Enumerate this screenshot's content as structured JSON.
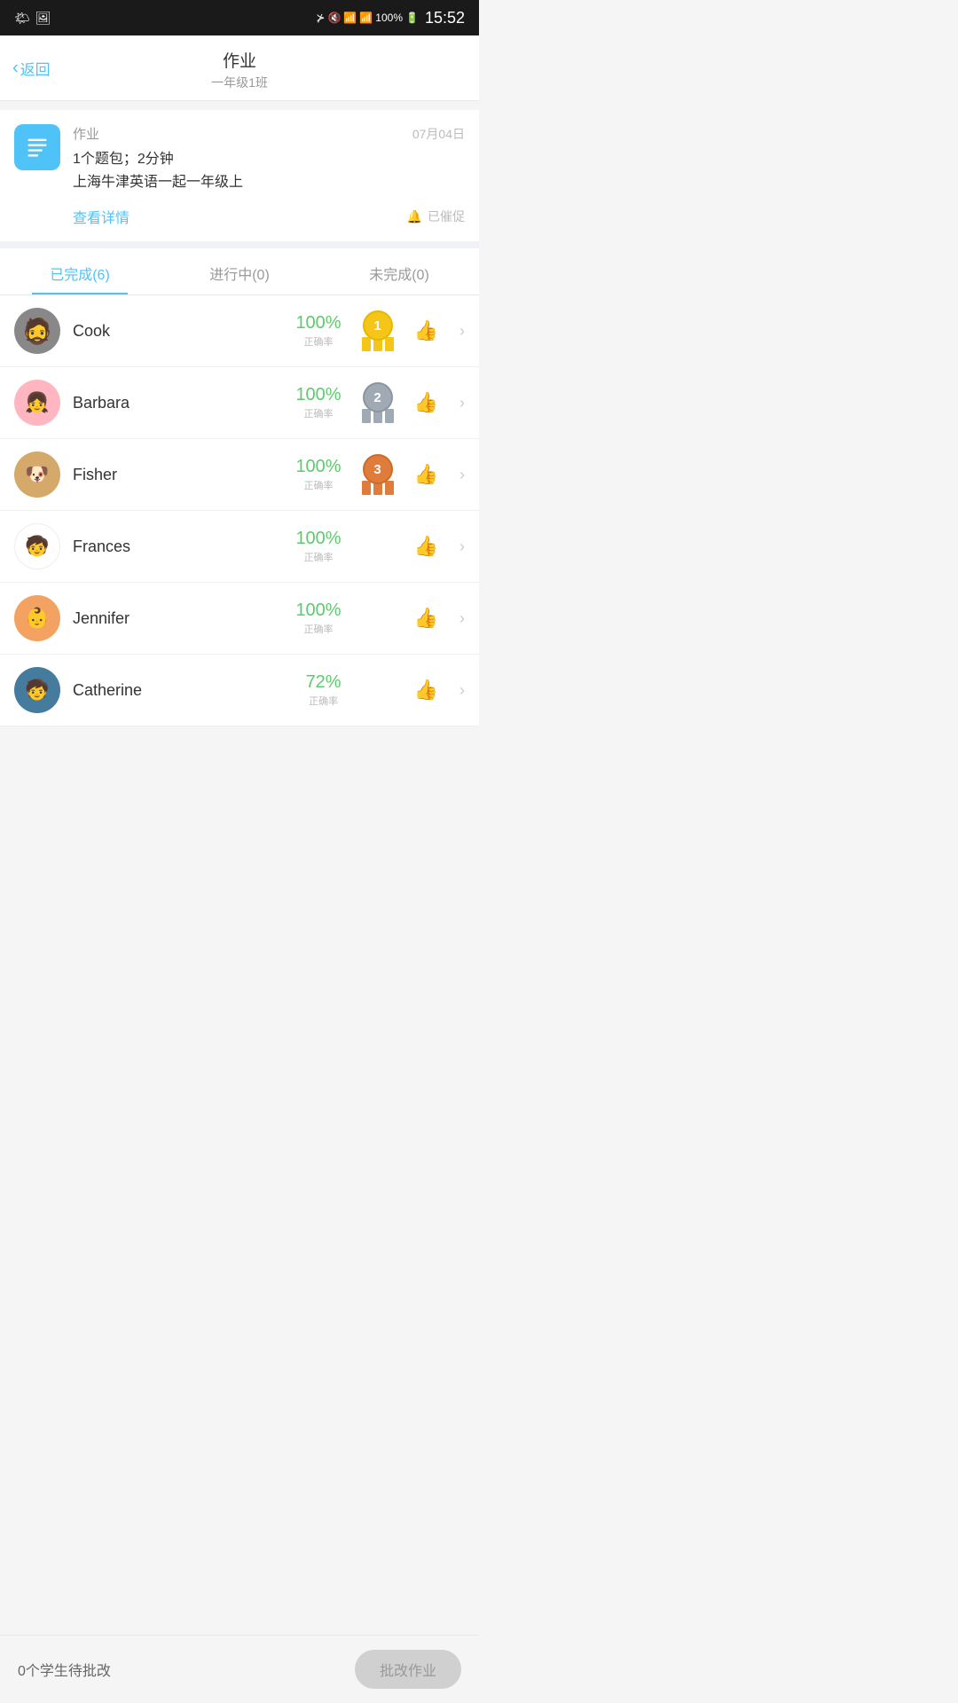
{
  "statusBar": {
    "time": "15:52",
    "battery": "100%"
  },
  "header": {
    "backLabel": "返回",
    "title": "作业",
    "subtitle": "一年级1班"
  },
  "assignment": {
    "label": "作业",
    "date": "07月04日",
    "desc1": "1个题包；2分钟",
    "desc2": "上海牛津英语一起一年级上",
    "viewDetail": "查看详情",
    "notifyLabel": "已催促"
  },
  "tabs": [
    {
      "label": "已完成(6)",
      "active": true
    },
    {
      "label": "进行中(0)",
      "active": false
    },
    {
      "label": "未完成(0)",
      "active": false
    }
  ],
  "students": [
    {
      "name": "Cook",
      "score": "100%",
      "scoreLabel": "正确率",
      "rank": 1,
      "avatarEmoji": "🧔"
    },
    {
      "name": "Barbara",
      "score": "100%",
      "scoreLabel": "正确率",
      "rank": 2,
      "avatarEmoji": "👧"
    },
    {
      "name": "Fisher",
      "score": "100%",
      "scoreLabel": "正确率",
      "rank": 3,
      "avatarEmoji": "🐶"
    },
    {
      "name": "Frances",
      "score": "100%",
      "scoreLabel": "正确率",
      "rank": 0,
      "avatarEmoji": "🧒"
    },
    {
      "name": "Jennifer",
      "score": "100%",
      "scoreLabel": "正确率",
      "rank": 0,
      "avatarEmoji": "👶"
    },
    {
      "name": "Catherine",
      "score": "72%",
      "scoreLabel": "正确率",
      "rank": 0,
      "avatarEmoji": "🧒"
    }
  ],
  "footer": {
    "pendingText": "0个学生待批改",
    "gradeBtn": "批改作业"
  }
}
